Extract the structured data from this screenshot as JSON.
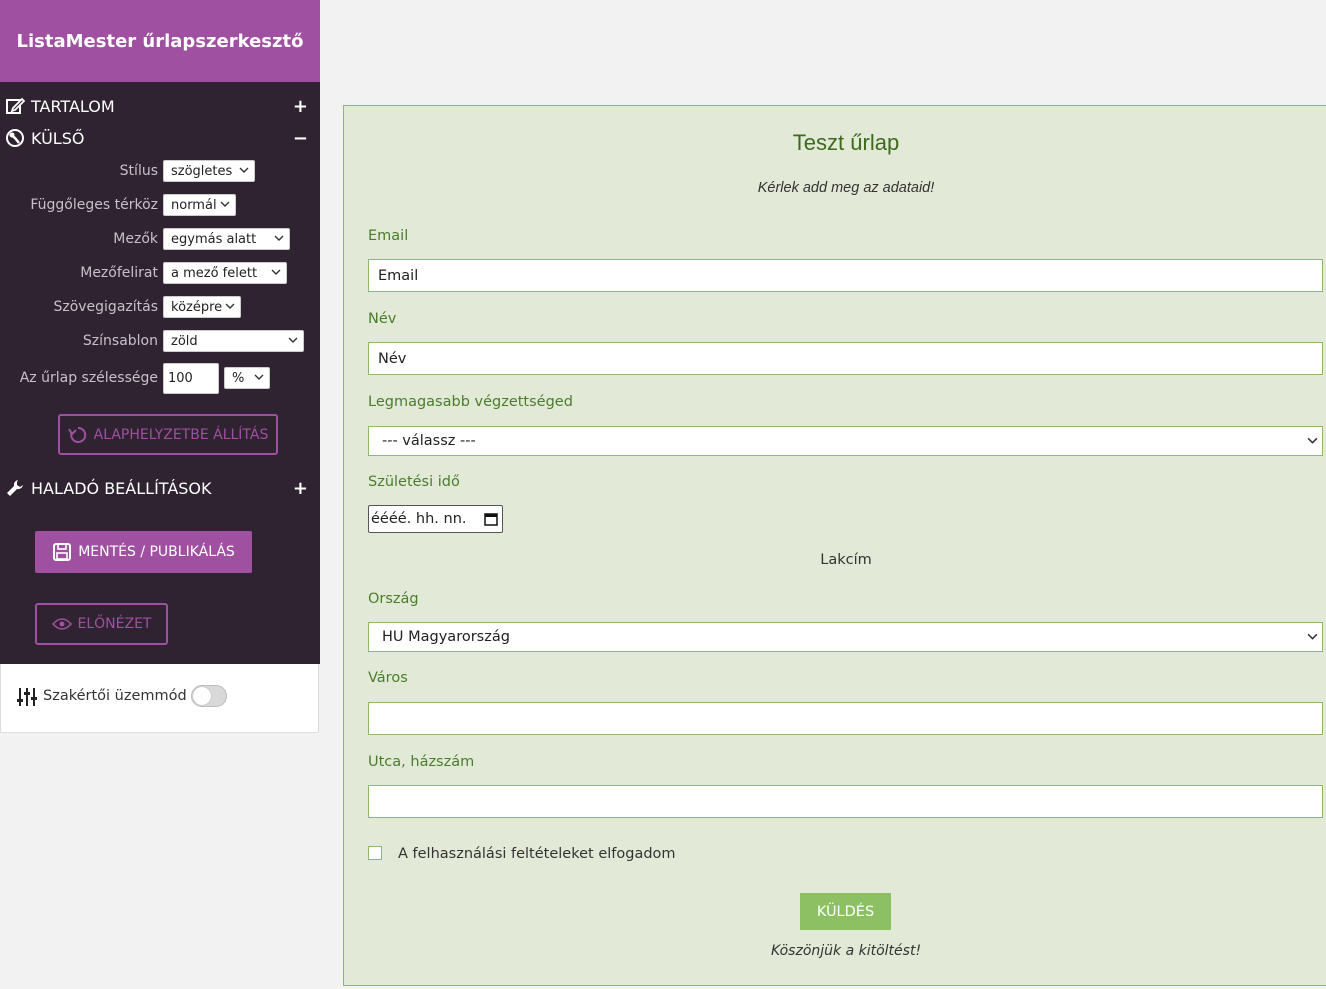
{
  "app": {
    "title": "ListaMester űrlapszerkesztő"
  },
  "sidebar": {
    "sections": {
      "content": {
        "label": "TARTALOM",
        "toggle": "+"
      },
      "appearance": {
        "label": "KÜLSŐ",
        "toggle": "−"
      },
      "advanced": {
        "label": "HALADÓ BEÁLLÍTÁSOK",
        "toggle": "+"
      }
    },
    "settings": {
      "style": {
        "label": "Stílus",
        "value": "szögletes"
      },
      "vertical_spacing": {
        "label": "Függőleges térköz",
        "value": "normál"
      },
      "fields": {
        "label": "Mezők",
        "value": "egymás alatt"
      },
      "field_label": {
        "label": "Mezőfelirat",
        "value": "a mező felett"
      },
      "text_align": {
        "label": "Szövegigazítás",
        "value": "középre"
      },
      "color_template": {
        "label": "Színsablon",
        "value": "zöld"
      },
      "form_width": {
        "label": "Az űrlap szélessége",
        "value": "100",
        "unit": "%"
      }
    },
    "reset_button": "ALAPHELYZETBE ÁLLÍTÁS",
    "save_button": "MENTÉS / PUBLIKÁLÁS",
    "preview_button": "ELŐNÉZET",
    "expert_mode": {
      "label": "Szakértői üzemmód",
      "enabled": false
    }
  },
  "form": {
    "title": "Teszt űrlap",
    "subtitle": "Kérlek add meg az adataid!",
    "email": {
      "label": "Email",
      "placeholder": "Email"
    },
    "name": {
      "label": "Név",
      "placeholder": "Név"
    },
    "education": {
      "label": "Legmagasabb végzettséged",
      "value": "--- válassz ---"
    },
    "birth_date": {
      "label": "Születési idő",
      "placeholder": "éééé. hh. nn."
    },
    "address_heading": "Lakcím",
    "country": {
      "label": "Ország",
      "value": "HU Magyarország"
    },
    "city": {
      "label": "Város",
      "value": ""
    },
    "street": {
      "label": "Utca, házszám",
      "value": ""
    },
    "terms": {
      "label": "A felhasználási feltételeket elfogadom",
      "checked": false
    },
    "submit_button": "KÜLDÉS",
    "thanks": "Köszönjük a kitöltést!"
  },
  "colors": {
    "brand_purple": "#a050a0",
    "sidebar_bg": "#2f2332",
    "form_bg": "#e2ead7",
    "form_green": "#4a7d2b",
    "button_green": "#8cc063"
  }
}
